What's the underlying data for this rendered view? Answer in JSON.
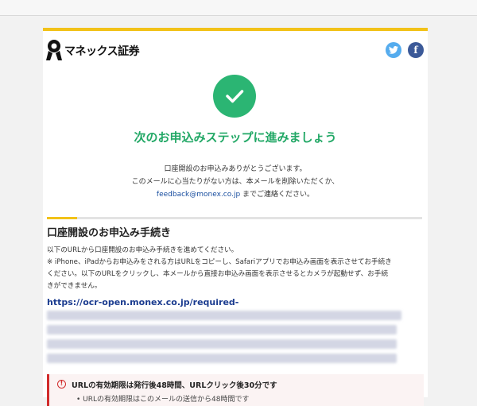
{
  "header": {
    "brand": "マネックス証券",
    "twitter_icon": "twitter-icon",
    "facebook_icon": "facebook-icon",
    "facebook_glyph": "f",
    "accent_color": "#f2c218"
  },
  "hero": {
    "icon": "check-circle-icon",
    "check_color": "#2bb573",
    "headline": "次のお申込みステップに進みましょう"
  },
  "intro": {
    "line1": "口座開設のお申込みありがとうございます。",
    "line2": "このメールに心当たりがない方は、本メールを削除いただくか、",
    "email": "feedback@monex.co.jp",
    "line3_suffix": " までご連絡ください。"
  },
  "section": {
    "title": "口座開設のお申込み手続き",
    "line1": "以下のURLから口座開設のお申込み手続きを進めてください。",
    "line2": "※ iPhone、iPadからお申込みをされる方はURLをコピーし、Safariアプリでお申込み画面を表示させてお手続き",
    "line3": "ください。以下のURLをクリックし、本メールから直接お申込み画面を表示させるとカメラが起動せず、お手続",
    "line4": "きができません。",
    "url": "https://ocr-open.monex.co.jp/required-"
  },
  "notice": {
    "icon": "alert-circle-icon",
    "title": "URLの有効期限は発行後48時間、URLクリック後30分です",
    "sub": "• URLの有効期限はこのメールの送信から48時間です",
    "border_color": "#d12c2c"
  }
}
